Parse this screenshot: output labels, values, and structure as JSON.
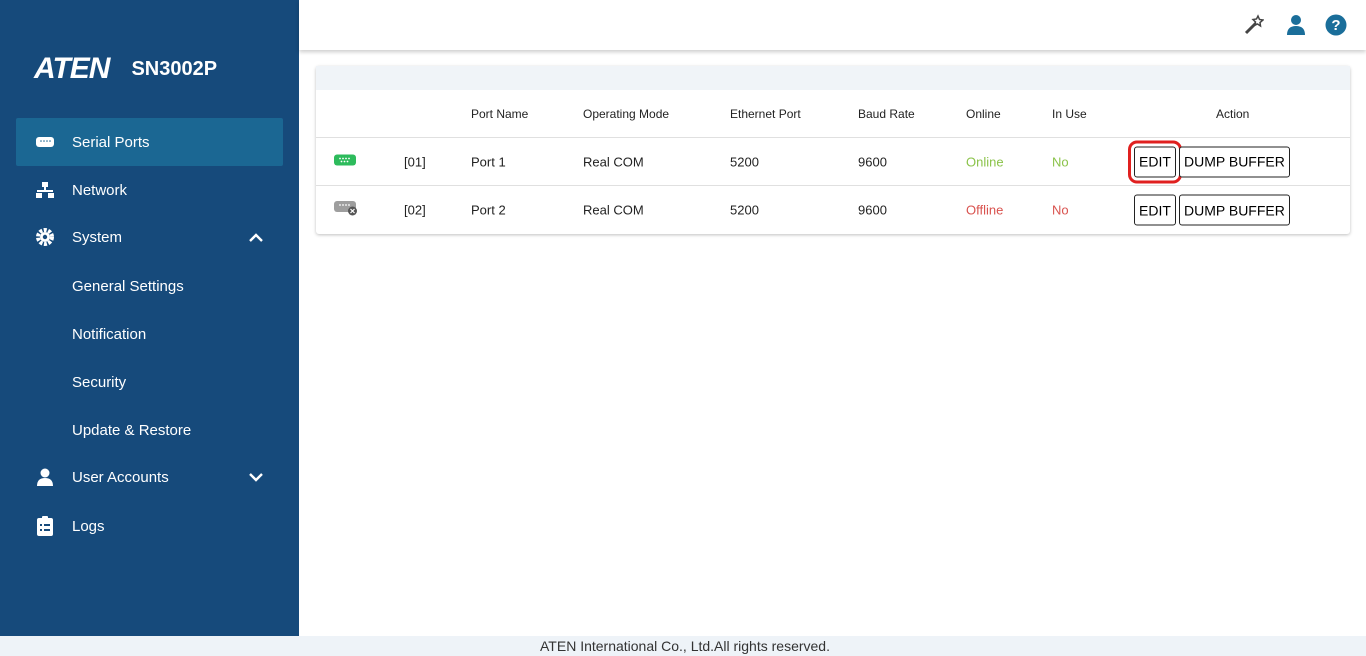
{
  "brand": {
    "logo": "ATEN",
    "model": "SN3002P"
  },
  "sidebar": {
    "items": [
      {
        "label": "Serial Ports",
        "icon": "serial-port-icon",
        "active": true
      },
      {
        "label": "Network",
        "icon": "network-icon"
      },
      {
        "label": "System",
        "icon": "gear-icon",
        "expanded": true
      },
      {
        "label": "General Settings"
      },
      {
        "label": "Notification"
      },
      {
        "label": "Security"
      },
      {
        "label": "Update & Restore"
      },
      {
        "label": "User Accounts",
        "icon": "user-icon",
        "expanded": false
      },
      {
        "label": "Logs",
        "icon": "clipboard-icon"
      }
    ]
  },
  "table": {
    "headers": [
      "Port Name",
      "Operating Mode",
      "Ethernet Port",
      "Baud Rate",
      "Online",
      "In Use",
      "Action"
    ],
    "rows": [
      {
        "index": "[01]",
        "name": "Port 1",
        "mode": "Real COM",
        "eth": "5200",
        "baud": "9600",
        "online": "Online",
        "inuse": "No",
        "status_color": "#8bc34a",
        "edit": "EDIT",
        "dump": "DUMP BUFFER"
      },
      {
        "index": "[02]",
        "name": "Port 2",
        "mode": "Real COM",
        "eth": "5200",
        "baud": "9600",
        "online": "Offline",
        "inuse": "No",
        "status_color": "#d9534f",
        "edit": "EDIT",
        "dump": "DUMP BUFFER"
      }
    ]
  },
  "footer": "ATEN International Co., Ltd.All rights reserved."
}
